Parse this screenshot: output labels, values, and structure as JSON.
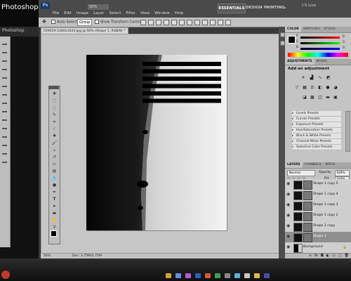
{
  "background_window": {
    "title": "Photoshop Cs5 Tut",
    "small_title": "Photoshop"
  },
  "app": {
    "logo": "Ps",
    "menus": [
      "File",
      "Edit",
      "Image",
      "Layer",
      "Select",
      "Filter",
      "View",
      "Window",
      "Help"
    ],
    "zoom": "50%",
    "workspaces": [
      "ESSENTIALS",
      "DESIGN",
      "PAINTING"
    ],
    "cs_live": "CS Live"
  },
  "options_bar": {
    "auto_select_label": "Auto-Select:",
    "auto_select_value": "Group",
    "show_transform": "Show Transform Controls"
  },
  "document": {
    "tab_title": "559559-1280x1024.jpg @ 50% (Shape 1, RGB/8) *",
    "status_zoom": "50%",
    "status_doc": "Doc: 3.75M/3.75M",
    "stripe_count": 6
  },
  "color_panel": {
    "tabs": [
      "COLOR",
      "SWATCHES",
      "STYLES"
    ],
    "channels": [
      {
        "label": "R",
        "value": "0",
        "color": "#cc2222"
      },
      {
        "label": "G",
        "value": "0",
        "color": "#22aa22"
      },
      {
        "label": "B",
        "value": "0",
        "color": "#2244cc"
      }
    ]
  },
  "adjustments_panel": {
    "tabs": [
      "ADJUSTMENTS",
      "MASKS"
    ],
    "title": "Add an adjustment",
    "presets": [
      "Levels Presets",
      "Curves Presets",
      "Exposure Presets",
      "Hue/Saturation Presets",
      "Black & White Presets",
      "Channel Mixer Presets",
      "Selective Color Presets"
    ]
  },
  "layers_panel": {
    "tabs": [
      "LAYERS",
      "CHANNELS",
      "PATHS"
    ],
    "blend_mode": "Normal",
    "opacity_label": "Opacity:",
    "opacity_value": "100%",
    "fill_label": "Fill:",
    "fill_value": "100%",
    "layers": [
      "Shape 1 copy 5",
      "Shape 1 copy 4",
      "Shape 1 copy 3",
      "Shape 1 copy 2",
      "Shape 1 copy",
      "Shape 1",
      "Background"
    ],
    "selected_index": 5
  },
  "colors": {
    "accent": "#d83b2b",
    "panel": "#c4c4c4",
    "chrome": "#4a4a4a"
  }
}
